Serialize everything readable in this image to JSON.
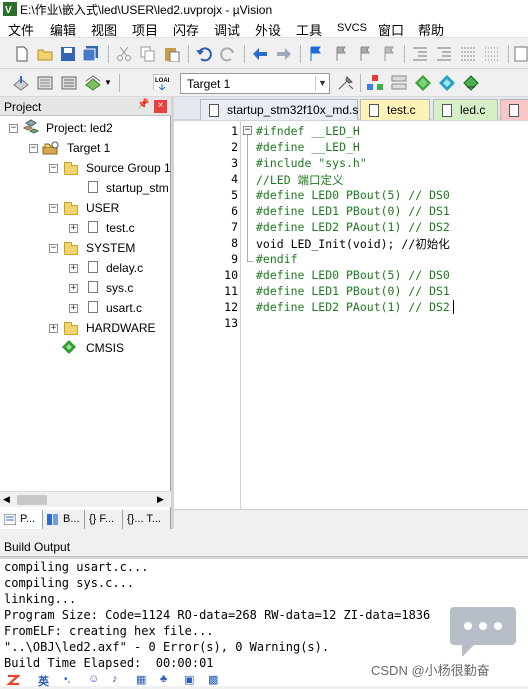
{
  "window": {
    "title": "E:\\作业\\嵌入式\\led\\USER\\led2.uvprojx - µVision",
    "app_icon": "keil-uvision-icon"
  },
  "menu": [
    "文件",
    "编辑",
    "视图",
    "项目",
    "闪存",
    "调试",
    "外设",
    "工具",
    "SVCS",
    "窗口",
    "帮助"
  ],
  "toolbar2": {
    "target_select": "Target 1"
  },
  "project_panel": {
    "title": "Project",
    "root": "Project: led2",
    "target": "Target 1",
    "groups": [
      {
        "name": "Source Group 1",
        "files": [
          "startup_stm"
        ]
      },
      {
        "name": "USER",
        "files": [
          "test.c"
        ]
      },
      {
        "name": "SYSTEM",
        "files": [
          "delay.c",
          "sys.c",
          "usart.c"
        ]
      },
      {
        "name": "HARDWARE",
        "files": []
      }
    ],
    "cmsis": "CMSIS",
    "bottom_tabs": [
      "P...",
      "B...",
      "{} F...",
      "{}... T..."
    ]
  },
  "editor": {
    "tabs": [
      {
        "label": "startup_stm32f10x_md.s",
        "active": false,
        "color": "#e8ecf4"
      },
      {
        "label": "test.c",
        "active": false,
        "color": "#fdf3b8"
      },
      {
        "label": "led.c",
        "active": false,
        "color": "#d6efc7"
      },
      {
        "label": "",
        "active": true,
        "color": "#f7c6c6"
      }
    ],
    "lines": [
      {
        "n": "1",
        "text": "#ifndef __LED_H"
      },
      {
        "n": "2",
        "text": "#define __LED_H"
      },
      {
        "n": "3",
        "text": "#include \"sys.h\""
      },
      {
        "n": "4",
        "text": "//LED 端口定义"
      },
      {
        "n": "5",
        "text": "#define LED0 PBout(5) // DS0"
      },
      {
        "n": "6",
        "text": "#define LED1 PBout(0) // DS1"
      },
      {
        "n": "7",
        "text": "#define LED2 PAout(1) // DS2"
      },
      {
        "n": "8",
        "text": "void LED_Init(void); //初始化"
      },
      {
        "n": "9",
        "text": "#endif"
      },
      {
        "n": "10",
        "text": "#define LED0 PBout(5) // DS0"
      },
      {
        "n": "11",
        "text": "#define LED1 PBout(0) // DS1"
      },
      {
        "n": "12",
        "text": "#define LED2 PAout(1) // DS2"
      },
      {
        "n": "13",
        "text": ""
      }
    ]
  },
  "build_output": {
    "title": "Build Output",
    "lines": [
      "compiling usart.c...",
      "compiling sys.c...",
      "linking...",
      "Program Size: Code=1124 RO-data=268 RW-data=12 ZI-data=1836",
      "FromELF: creating hex file...",
      "\"..\\OBJ\\led2.axf\" - 0 Error(s), 0 Warning(s).",
      "Build Time Elapsed:  00:00:01"
    ]
  },
  "watermark": "CSDN @小杨很勤奋",
  "ime": {
    "lang": "英"
  }
}
